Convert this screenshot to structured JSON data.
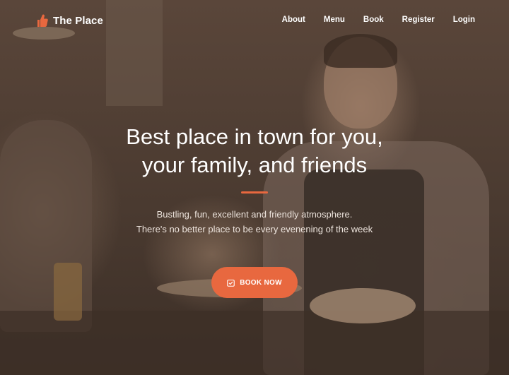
{
  "brand": {
    "name": "The Place",
    "icon": "thumbs-up-icon",
    "icon_color": "#e8683f"
  },
  "nav": {
    "items": [
      {
        "label": "About"
      },
      {
        "label": "Menu"
      },
      {
        "label": "Book"
      },
      {
        "label": "Register"
      },
      {
        "label": "Login"
      }
    ]
  },
  "hero": {
    "headline_line1": "Best place in town for you,",
    "headline_line2": "your family, and friends",
    "subtext_line1": "Bustling, fun, excellent and friendly atmosphere.",
    "subtext_line2": "There's no better place to be every evenening of the week",
    "cta_label": "BOOK NOW",
    "cta_icon": "calendar-check-icon"
  },
  "colors": {
    "accent": "#e8683f",
    "text": "#ffffff",
    "overlay": "#4a3a30"
  }
}
